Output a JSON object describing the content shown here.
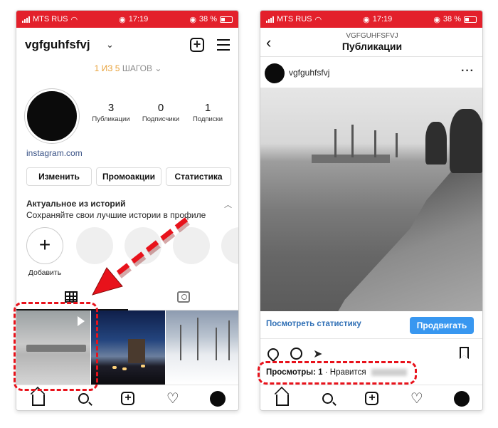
{
  "status": {
    "carrier": "MTS RUS",
    "time": "17:19",
    "battery": "38 %"
  },
  "profile": {
    "username": "vgfguhfsfvj",
    "steps_highlight": "1 ИЗ 5",
    "steps_rest": "ШАГОВ",
    "stats": [
      {
        "value": "3",
        "label": "Публикации"
      },
      {
        "value": "0",
        "label": "Подписчики"
      },
      {
        "value": "1",
        "label": "Подписки"
      }
    ],
    "link": "instagram.com",
    "buttons": [
      "Изменить",
      "Промоакции",
      "Статистика"
    ],
    "highlights_title": "Актуальное из историй",
    "highlights_sub": "Сохраняйте свои лучшие истории в профиле",
    "add_label": "Добавить"
  },
  "post": {
    "header_user": "VGFGUHFSFVJ",
    "header_title": "Публикации",
    "author": "vgfguhfsfvj",
    "view_stats": "Посмотреть статистику",
    "promote": "Продвигать",
    "views_label": "Просмотры: 1",
    "likes_label": "Нравится"
  },
  "icons": [
    "signal-icon",
    "wifi-icon",
    "alarm-icon",
    "battery-icon",
    "chevron-down-icon",
    "new-post-icon",
    "menu-icon",
    "grid-icon",
    "tagged-icon",
    "play-icon",
    "home-icon",
    "search-icon",
    "add-icon",
    "heart-icon",
    "back-icon",
    "more-icon",
    "comment-icon",
    "send-icon",
    "bookmark-icon"
  ],
  "colors": {
    "status_bar": "#e3202b",
    "annotation": "#e8121b",
    "promote": "#3897f0",
    "link": "#385185"
  }
}
